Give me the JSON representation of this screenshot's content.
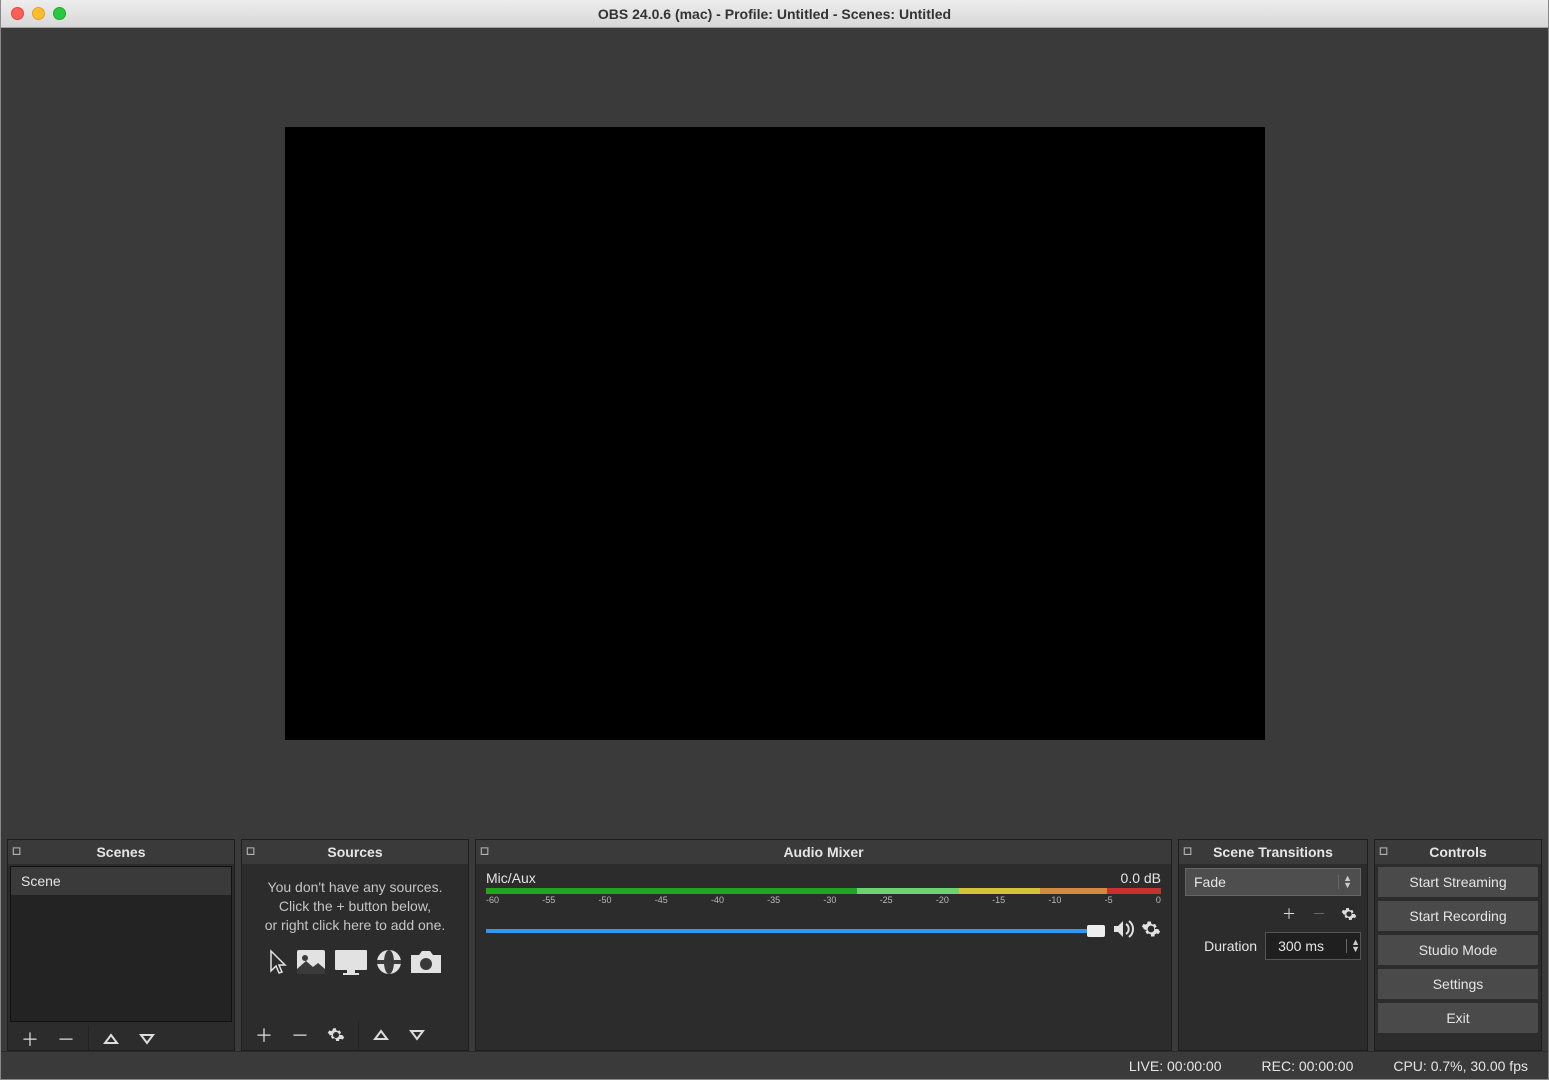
{
  "window": {
    "title": "OBS 24.0.6 (mac) - Profile: Untitled - Scenes: Untitled"
  },
  "panels": {
    "scenes": {
      "title": "Scenes",
      "items": [
        "Scene"
      ]
    },
    "sources": {
      "title": "Sources",
      "empty_line1": "You don't have any sources.",
      "empty_line2": "Click the + button below,",
      "empty_line3": "or right click here to add one."
    },
    "mixer": {
      "title": "Audio Mixer",
      "channel_name": "Mic/Aux",
      "level": "0.0 dB",
      "ticks": [
        "-60",
        "-55",
        "-50",
        "-45",
        "-40",
        "-35",
        "-30",
        "-25",
        "-20",
        "-15",
        "-10",
        "-5",
        "0"
      ]
    },
    "transitions": {
      "title": "Scene Transitions",
      "selected": "Fade",
      "duration_label": "Duration",
      "duration_value": "300 ms"
    },
    "controls": {
      "title": "Controls",
      "buttons": {
        "stream": "Start Streaming",
        "record": "Start Recording",
        "studio": "Studio Mode",
        "settings": "Settings",
        "exit": "Exit"
      }
    }
  },
  "status": {
    "live": "LIVE: 00:00:00",
    "rec": "REC: 00:00:00",
    "cpu": "CPU: 0.7%, 30.00 fps"
  }
}
